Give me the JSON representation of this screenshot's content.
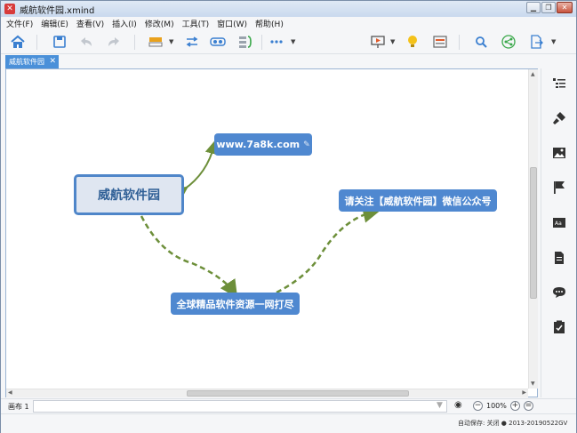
{
  "window": {
    "title": "威航软件园.xmind",
    "controls": {
      "minimize": "▁",
      "restore": "❐",
      "close": "✕"
    }
  },
  "menu": [
    "文件(F)",
    "编辑(E)",
    "查看(V)",
    "插入(I)",
    "修改(M)",
    "工具(T)",
    "窗口(W)",
    "帮助(H)"
  ],
  "toolbar": {
    "icons": [
      "home-icon",
      "save-icon",
      "undo-icon",
      "redo-icon",
      "style-icon",
      "relationship-icon",
      "boundary-icon",
      "summary-icon",
      "more-icon",
      "present-icon",
      "idea-icon",
      "outline-icon",
      "search-icon",
      "share-icon",
      "export-icon"
    ]
  },
  "tab": {
    "label": "威航软件园",
    "close": "✕"
  },
  "map": {
    "central": "威航软件园",
    "topics": {
      "web": "www.7a8k.com",
      "wechat": "请关注【威航软件园】微信公众号",
      "global": "全球精品软件资源一网打尽"
    },
    "colors": {
      "topic": "#4f88d0",
      "central_border": "#4f86c9",
      "connector": "#6d8f3a"
    }
  },
  "status": {
    "sheet_label": "画布 1",
    "zoom": "100%",
    "autosave": "自动保存: 关闭   ● 2013-20190522GV"
  }
}
